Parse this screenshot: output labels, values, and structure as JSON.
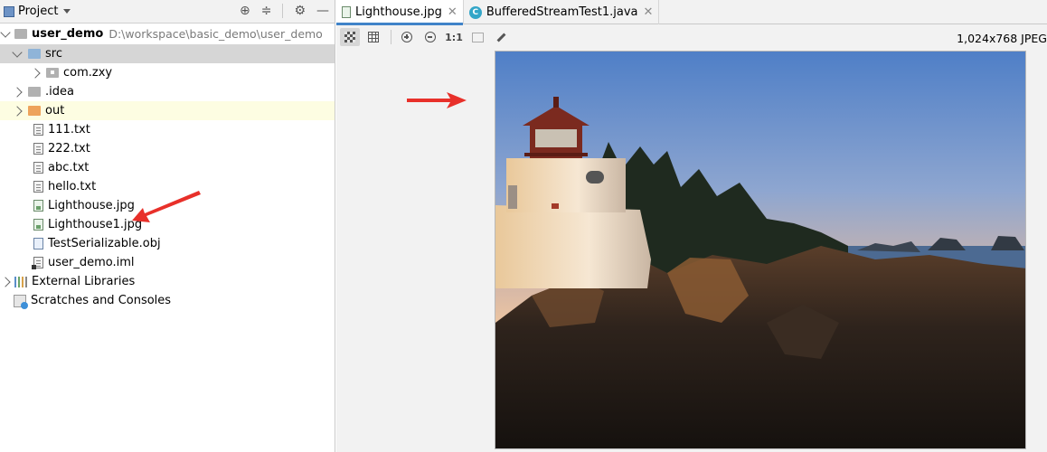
{
  "project_panel": {
    "title": "Project",
    "tools": [
      "locate-icon",
      "collapse-icon",
      "gear-icon",
      "minimize-icon"
    ],
    "tree": [
      {
        "label": "user_demo",
        "path": "D:\\workspace\\basic_demo\\user_demo",
        "icon": "module-folder-icon"
      },
      {
        "label": "src",
        "icon": "source-folder-icon"
      },
      {
        "label": "com.zxy",
        "icon": "package-icon"
      },
      {
        "label": ".idea",
        "icon": "folder-icon"
      },
      {
        "label": "out",
        "icon": "excluded-folder-icon"
      },
      {
        "label": "111.txt",
        "icon": "text-file-icon"
      },
      {
        "label": "222.txt",
        "icon": "text-file-icon"
      },
      {
        "label": "abc.txt",
        "icon": "text-file-icon"
      },
      {
        "label": "hello.txt",
        "icon": "text-file-icon"
      },
      {
        "label": "Lighthouse.jpg",
        "icon": "image-file-icon"
      },
      {
        "label": "Lighthouse1.jpg",
        "icon": "image-file-icon"
      },
      {
        "label": "TestSerializable.obj",
        "icon": "unknown-file-icon"
      },
      {
        "label": "user_demo.iml",
        "icon": "module-file-icon"
      },
      {
        "label": "External Libraries",
        "icon": "libraries-icon"
      },
      {
        "label": "Scratches and Consoles",
        "icon": "scratches-icon"
      }
    ]
  },
  "editor": {
    "tabs": [
      {
        "label": "Lighthouse.jpg",
        "icon": "image-file-icon",
        "active": true
      },
      {
        "label": "BufferedStreamTest1.java",
        "icon": "java-class-icon",
        "active": false
      }
    ],
    "toolbar": {
      "actual_size": "1:1",
      "image_size": "1,024x768 JPEG"
    }
  },
  "colors": {
    "selection": "#d6d6d6",
    "highlight_row": "#fdfde2",
    "tab_underline": "#4083c9",
    "annotation_arrow": "#e8302a"
  }
}
